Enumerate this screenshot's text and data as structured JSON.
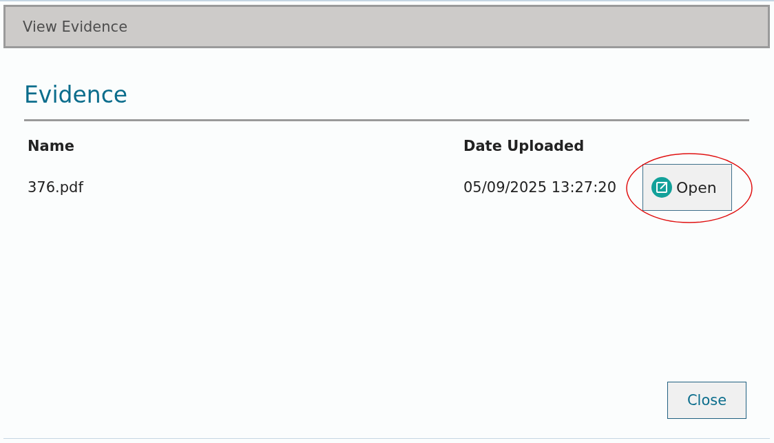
{
  "dialog": {
    "title": "View Evidence"
  },
  "section": {
    "heading": "Evidence"
  },
  "table": {
    "columns": [
      "Name",
      "Date Uploaded"
    ],
    "rows": [
      {
        "name": "376.pdf",
        "date_uploaded": "05/09/2025 13:27:20",
        "action": "Open"
      }
    ]
  },
  "annotations": [
    {
      "kind": "ellipse"
    }
  ],
  "buttons": [
    "Close"
  ]
}
